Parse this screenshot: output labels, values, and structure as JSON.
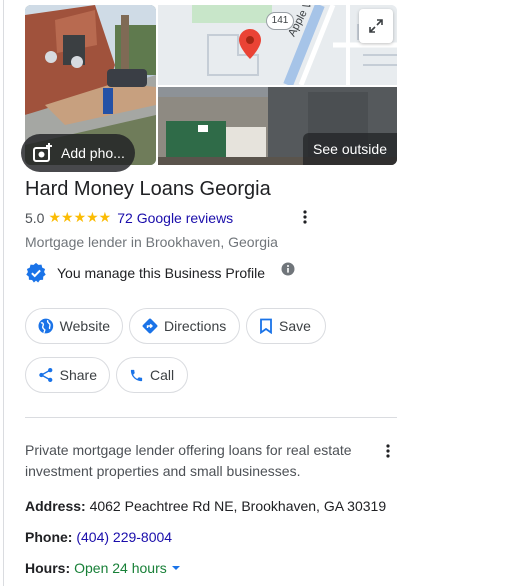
{
  "photos": {
    "add_photo_label": "Add pho...",
    "see_outside_label": "See outside",
    "map_route_label": "141",
    "map_road_label": "Apple Valley Rd N"
  },
  "business": {
    "name": "Hard Money Loans Georgia",
    "rating": "5.0",
    "stars": "★★★★★",
    "reviews_label": "72 Google reviews",
    "category": "Mortgage lender in Brookhaven, Georgia",
    "manage_text": "You manage this Business Profile"
  },
  "actions": {
    "website": "Website",
    "directions": "Directions",
    "save": "Save",
    "share": "Share",
    "call": "Call"
  },
  "about": {
    "description": "Private mortgage lender offering loans for real estate investment properties and small businesses."
  },
  "attributes": {
    "address_label": "Address:",
    "address_value": "4062 Peachtree Rd NE, Brookhaven, GA 30319",
    "phone_label": "Phone:",
    "phone_value": "(404) 229-8004",
    "hours_label": "Hours:",
    "hours_value": "Open 24 hours"
  },
  "colors": {
    "link": "#1a0dab",
    "accent_blue": "#1a73e8",
    "star": "#fbbc04",
    "open_green": "#188038"
  },
  "icons": [
    "add-photo-icon",
    "expand-icon",
    "more-vert-icon",
    "verified-icon",
    "info-icon",
    "globe-icon",
    "directions-icon",
    "bookmark-icon",
    "share-icon",
    "phone-icon",
    "dropdown-arrow-icon",
    "map-pin-icon"
  ]
}
